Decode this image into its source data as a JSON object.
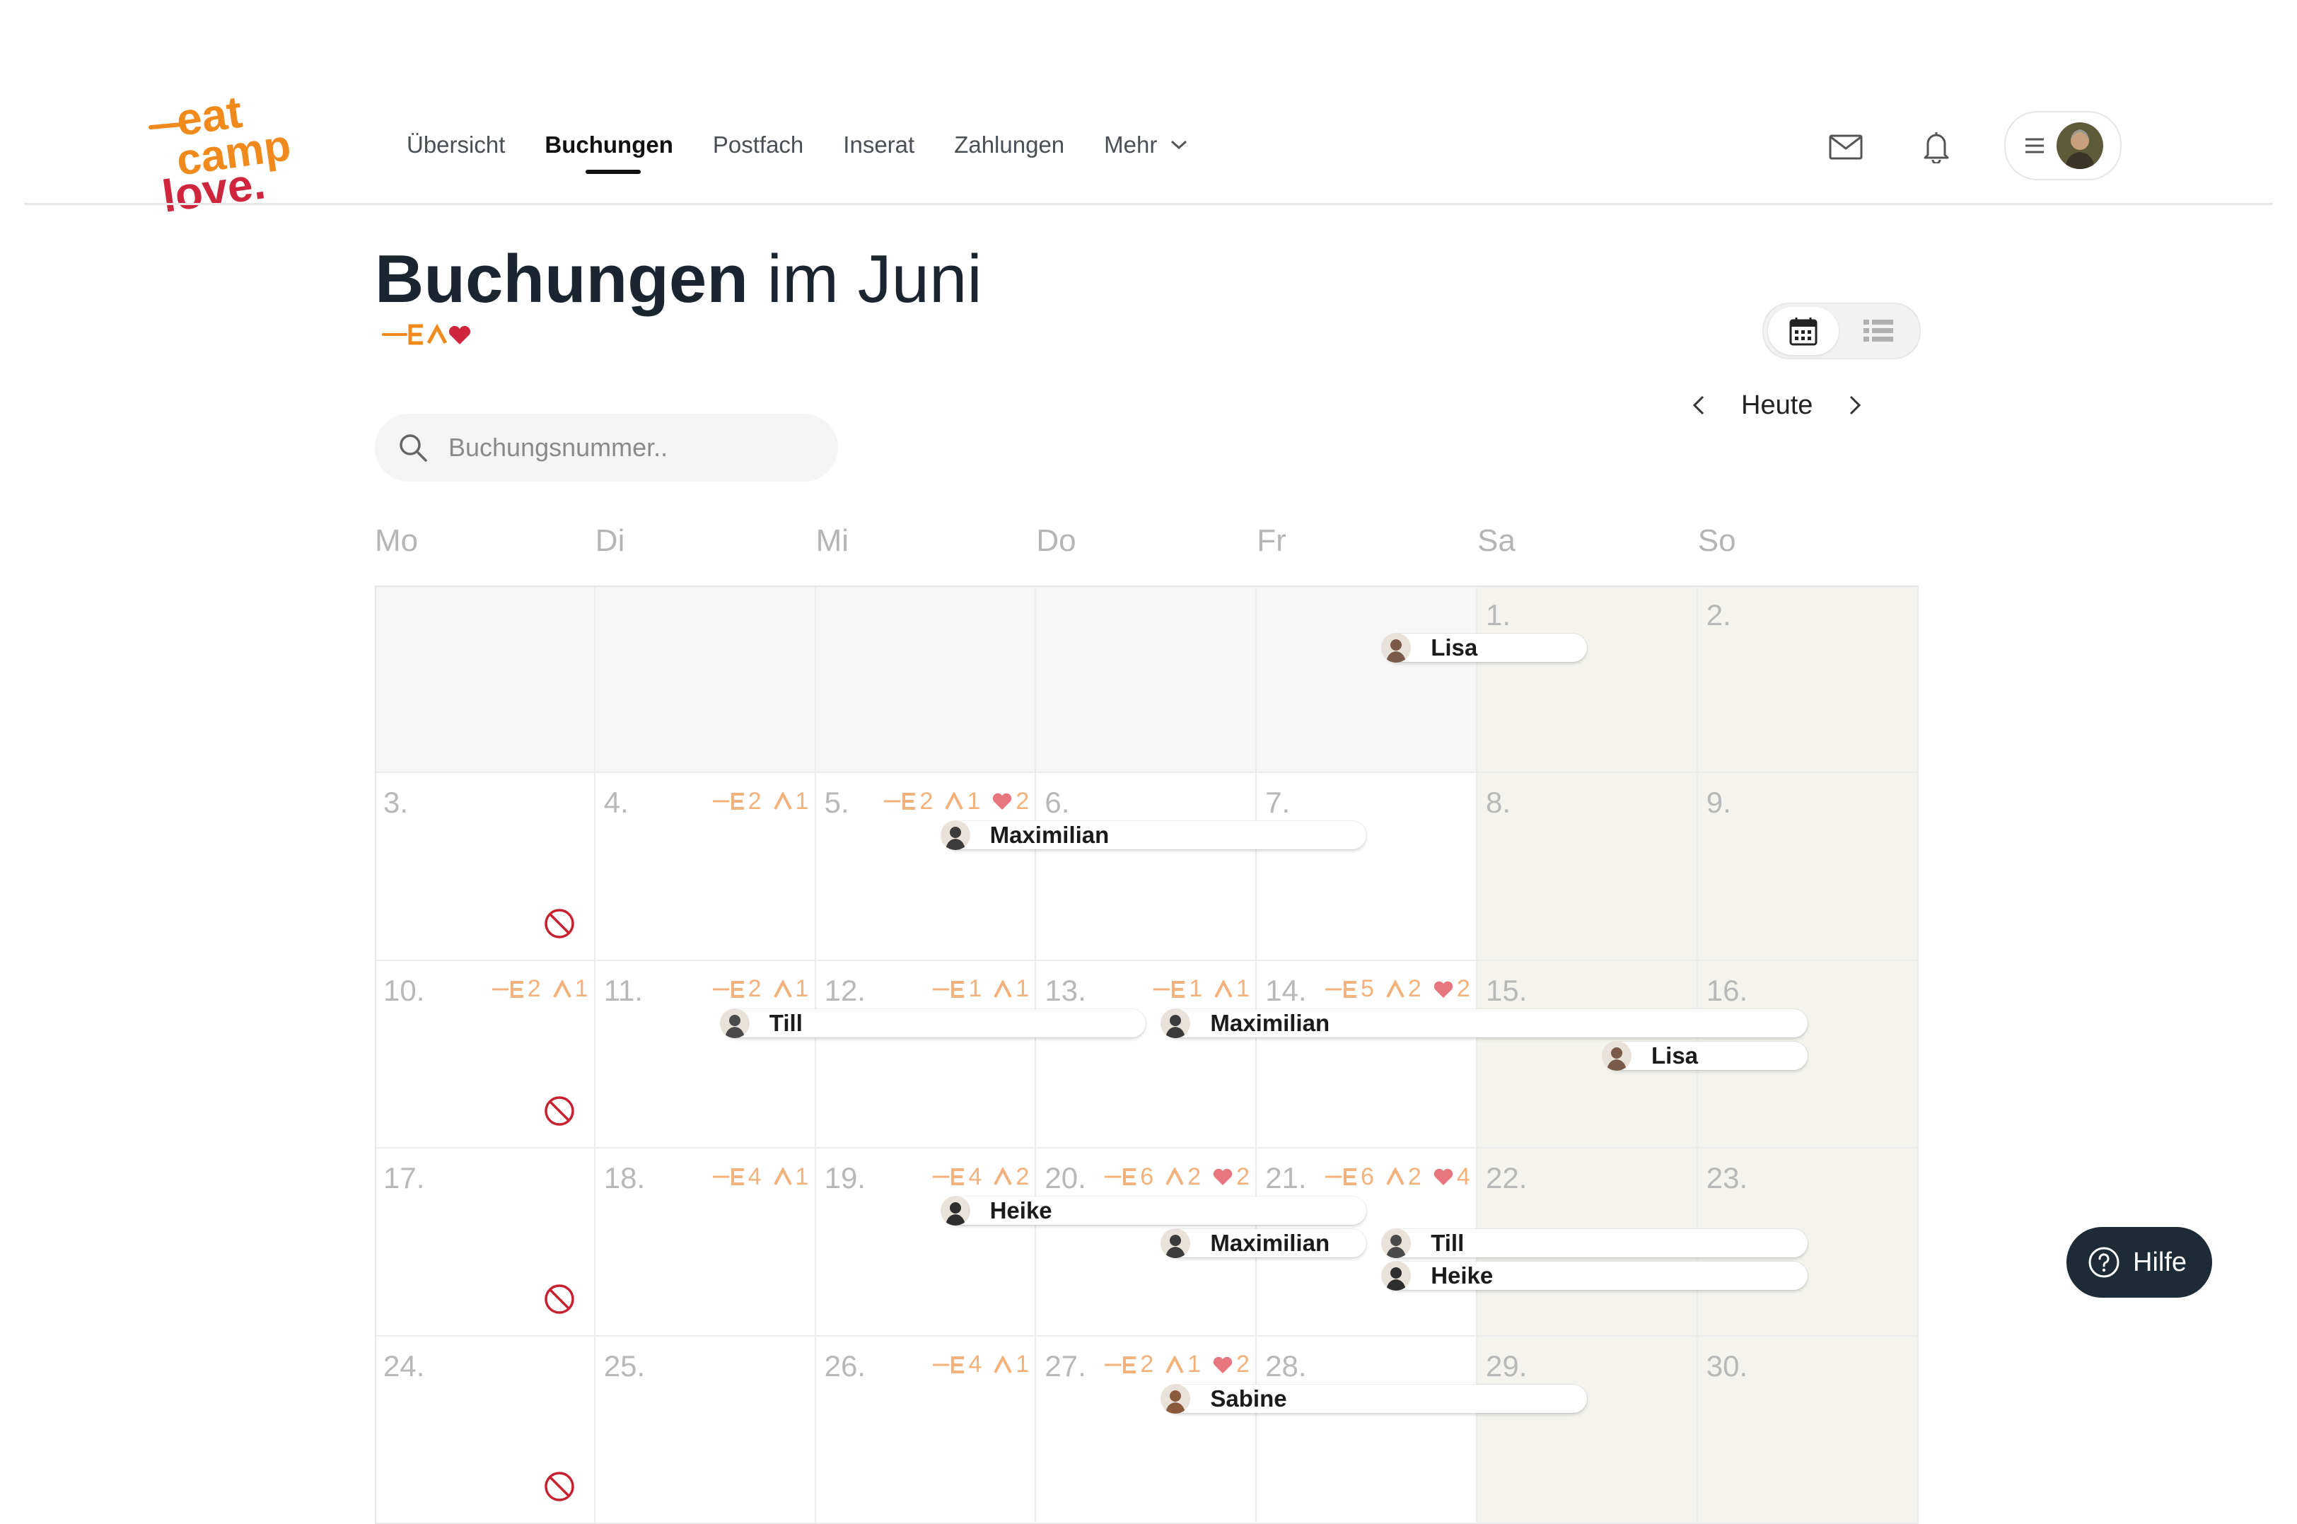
{
  "brand": {
    "logo_line1": "eat",
    "logo_line2": "camp",
    "logo_line3": "love.",
    "orange": "#f08a1c",
    "red": "#d0263d"
  },
  "nav": {
    "items": [
      "Übersicht",
      "Buchungen",
      "Postfach",
      "Inserat",
      "Zahlungen"
    ],
    "more": "Mehr",
    "active_index": 1
  },
  "header_icons": {
    "mail": "mail-icon",
    "bell": "bell-icon",
    "menu": "menu-icon"
  },
  "title": {
    "bold": "Buchungen",
    "rest": "im Juni"
  },
  "view_toggle": {
    "calendar": "calendar-icon",
    "list": "list-icon",
    "active": "calendar"
  },
  "month_nav": {
    "today": "Heute"
  },
  "search": {
    "placeholder": "Buchungsnummer.."
  },
  "weekdays": [
    "Mo",
    "Di",
    "Mi",
    "Do",
    "Fr",
    "Sa",
    "So"
  ],
  "calendar": {
    "rows": [
      {
        "days": [
          "",
          "",
          "",
          "",
          "",
          "1.",
          "2."
        ]
      },
      {
        "days": [
          "3.",
          "4.",
          "5.",
          "6.",
          "7.",
          "8.",
          "9."
        ]
      },
      {
        "days": [
          "10.",
          "11.",
          "12.",
          "13.",
          "14.",
          "15.",
          "16."
        ]
      },
      {
        "days": [
          "17.",
          "18.",
          "19.",
          "20.",
          "21.",
          "22.",
          "23."
        ]
      },
      {
        "days": [
          "24.",
          "25.",
          "26.",
          "27.",
          "28.",
          "29.",
          "30."
        ]
      }
    ],
    "stats": [
      {
        "row": 1,
        "col": 2,
        "meal": "2",
        "camp": "1",
        "love": ""
      },
      {
        "row": 1,
        "col": 3,
        "meal": "2",
        "camp": "1",
        "love": "2"
      },
      {
        "row": 2,
        "col": 1,
        "meal": "2",
        "camp": "1",
        "love": ""
      },
      {
        "row": 2,
        "col": 2,
        "meal": "2",
        "camp": "1",
        "love": ""
      },
      {
        "row": 2,
        "col": 3,
        "meal": "1",
        "camp": "1",
        "love": ""
      },
      {
        "row": 2,
        "col": 4,
        "meal": "1",
        "camp": "1",
        "love": ""
      },
      {
        "row": 2,
        "col": 5,
        "meal": "5",
        "camp": "2",
        "love": "2"
      },
      {
        "row": 3,
        "col": 2,
        "meal": "4",
        "camp": "1",
        "love": ""
      },
      {
        "row": 3,
        "col": 3,
        "meal": "4",
        "camp": "2",
        "love": ""
      },
      {
        "row": 3,
        "col": 4,
        "meal": "6",
        "camp": "2",
        "love": "2"
      },
      {
        "row": 3,
        "col": 5,
        "meal": "6",
        "camp": "2",
        "love": "4"
      },
      {
        "row": 4,
        "col": 3,
        "meal": "4",
        "camp": "1",
        "love": ""
      },
      {
        "row": 4,
        "col": 4,
        "meal": "2",
        "camp": "1",
        "love": "2"
      }
    ],
    "blocked_days": [
      "3.",
      "10.",
      "17.",
      "24."
    ],
    "bookings": [
      {
        "name": "Lisa",
        "row": 0,
        "start": 4,
        "end": 5,
        "lane": 0,
        "avatar": "#7a5a48"
      },
      {
        "name": "Maximilian",
        "row": 1,
        "start": 2,
        "end": 4,
        "lane": 0,
        "avatar": "#3b3b3b"
      },
      {
        "name": "Till",
        "row": 2,
        "start": 1,
        "end": 3,
        "lane": 0,
        "avatar": "#4a4a4a"
      },
      {
        "name": "Maximilian",
        "row": 2,
        "start": 3,
        "end": 6,
        "lane": 0,
        "avatar": "#3b3b3b"
      },
      {
        "name": "Lisa",
        "row": 2,
        "start": 5,
        "end": 6,
        "lane": 1,
        "avatar": "#7a5a48"
      },
      {
        "name": "Heike",
        "row": 3,
        "start": 2,
        "end": 4,
        "lane": 0,
        "avatar": "#2e2e2e"
      },
      {
        "name": "Maximilian",
        "row": 3,
        "start": 3,
        "end": 4,
        "lane": 1,
        "avatar": "#3b3b3b"
      },
      {
        "name": "Till",
        "row": 3,
        "start": 4,
        "end": 6,
        "lane": 1,
        "avatar": "#4a4a4a"
      },
      {
        "name": "Heike",
        "row": 3,
        "start": 4,
        "end": 6,
        "lane": 2,
        "avatar": "#2e2e2e"
      },
      {
        "name": "Sabine",
        "row": 4,
        "start": 3,
        "end": 5,
        "lane": 0,
        "avatar": "#8a5a3a"
      }
    ]
  },
  "help": {
    "label": "Hilfe"
  }
}
